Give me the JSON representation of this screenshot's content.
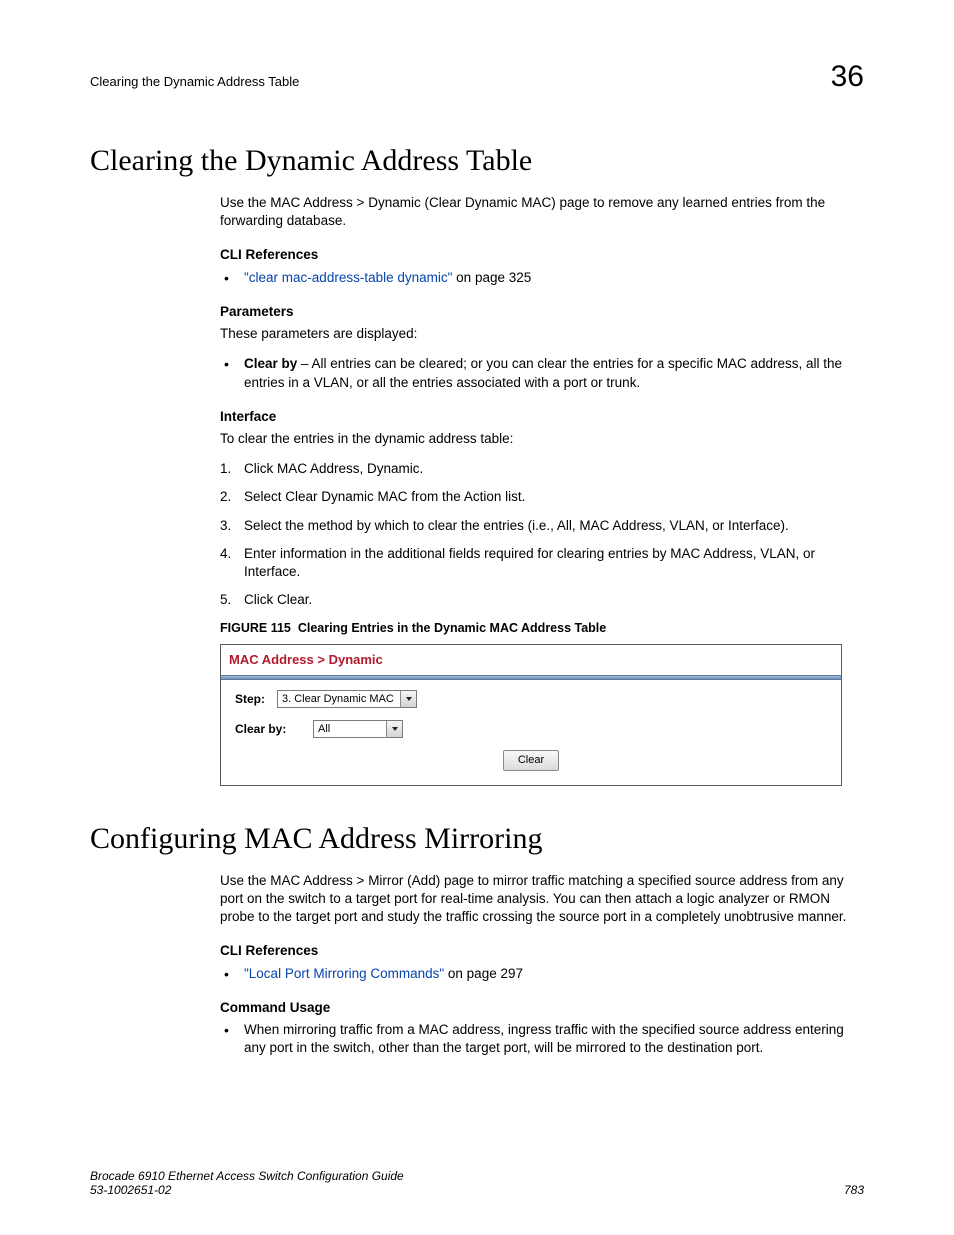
{
  "header": {
    "running_title": "Clearing the Dynamic Address Table",
    "chapter_number": "36"
  },
  "section1": {
    "title": "Clearing the Dynamic Address Table",
    "intro": "Use the MAC Address > Dynamic (Clear Dynamic MAC) page to remove any learned entries from the forwarding database.",
    "cli_ref_heading": "CLI References",
    "cli_ref_link": "\"clear mac-address-table dynamic\"",
    "cli_ref_tail": " on page 325",
    "params_heading": "Parameters",
    "params_intro": "These parameters are displayed:",
    "param_item_lead": "Clear by",
    "param_item_body": " – All entries can be cleared; or you can clear the entries for a specific MAC address, all the entries in a VLAN, or all the entries associated with a port or trunk.",
    "iface_heading": "Interface",
    "iface_intro": "To clear the entries in the dynamic address table:",
    "steps": [
      "Click MAC Address, Dynamic.",
      "Select Clear Dynamic MAC from the Action list.",
      "Select the method by which to clear the entries (i.e., All, MAC Address, VLAN, or Interface).",
      "Enter information in the additional fields required for clearing entries by MAC Address, VLAN, or Interface.",
      "Click Clear."
    ],
    "figure_label": "FIGURE 115",
    "figure_caption": "Clearing Entries in the Dynamic MAC Address Table",
    "figure": {
      "title": "MAC Address > Dynamic",
      "step_label": "Step:",
      "step_value": "3. Clear Dynamic MAC",
      "clearby_label": "Clear by:",
      "clearby_value": "All",
      "button": "Clear"
    }
  },
  "section2": {
    "title": "Configuring MAC Address Mirroring",
    "intro": "Use the MAC Address > Mirror (Add) page to mirror traffic matching a specified source address from any port on the switch to a target port for real-time analysis. You can then attach a logic analyzer or RMON probe to the target port and study the traffic crossing the source port in a completely unobtrusive manner.",
    "cli_ref_heading": "CLI References",
    "cli_ref_link": "\"Local Port Mirroring Commands\"",
    "cli_ref_tail": " on page 297",
    "cmd_usage_heading": "Command Usage",
    "cmd_usage_item": "When mirroring traffic from a MAC address, ingress traffic with the specified source address entering any port in the switch, other than the target port, will be mirrored to the destination port."
  },
  "footer": {
    "book": "Brocade 6910 Ethernet Access Switch Configuration Guide",
    "docnum": "53-1002651-02",
    "page": "783"
  }
}
